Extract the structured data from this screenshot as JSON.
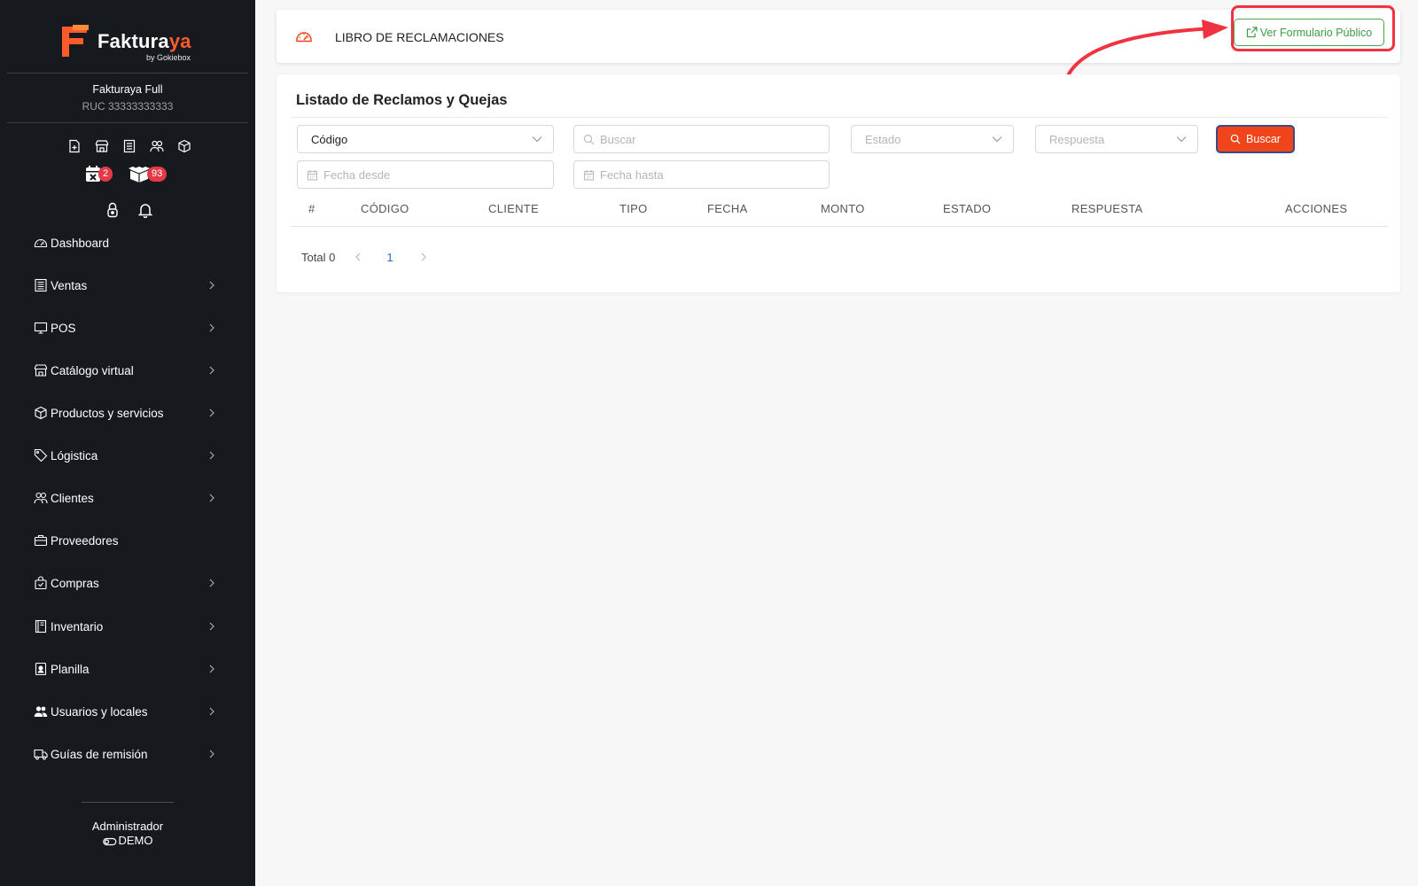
{
  "brand": {
    "name_main": "Faktura",
    "name_accent": "ya",
    "byline": "by Gokiebox",
    "accent_color": "#ff5a2c"
  },
  "company": {
    "name": "Fakturaya Full",
    "ruc": "RUC 33333333333"
  },
  "quick_icons": [
    "new-document-icon",
    "store-icon",
    "receipt-icon",
    "users-icon",
    "box-icon"
  ],
  "notifications": {
    "calendar_count": "2",
    "packages_count": "93"
  },
  "sidebar": {
    "items": [
      {
        "label": "Dashboard",
        "icon": "dashboard-icon",
        "has_children": false
      },
      {
        "label": "Ventas",
        "icon": "receipt-icon",
        "has_children": true
      },
      {
        "label": "POS",
        "icon": "monitor-icon",
        "has_children": true
      },
      {
        "label": "Catálogo virtual",
        "icon": "store-icon",
        "has_children": true
      },
      {
        "label": "Productos y servicios",
        "icon": "box-icon",
        "has_children": true
      },
      {
        "label": "Lógistica",
        "icon": "tag-icon",
        "has_children": true
      },
      {
        "label": "Clientes",
        "icon": "users-icon",
        "has_children": true
      },
      {
        "label": "Proveedores",
        "icon": "briefcase-icon",
        "has_children": false
      },
      {
        "label": "Compras",
        "icon": "shopping-bag-icon",
        "has_children": true
      },
      {
        "label": "Inventario",
        "icon": "book-icon",
        "has_children": true
      },
      {
        "label": "Planilla",
        "icon": "badge-icon",
        "has_children": true
      },
      {
        "label": "Usuarios y locales",
        "icon": "user-group-icon",
        "has_children": true
      },
      {
        "label": "Guías de remisión",
        "icon": "truck-icon",
        "has_children": true
      }
    ],
    "footer_role": "Administrador",
    "footer_mode": "DEMO"
  },
  "header": {
    "title": "LIBRO DE RECLAMACIONES",
    "public_form_button": "Ver Formulario Público",
    "highlight_color": "#ef3340"
  },
  "main": {
    "title": "Listado de Reclamos y Quejas",
    "filters": {
      "field_select": "Código",
      "search_placeholder": "Buscar",
      "estado_placeholder": "Estado",
      "respuesta_placeholder": "Respuesta",
      "date_from_placeholder": "Fecha desde",
      "date_to_placeholder": "Fecha hasta",
      "search_button": "Buscar"
    },
    "columns": [
      "#",
      "CÓDIGO",
      "CLIENTE",
      "TIPO",
      "FECHA",
      "MONTO",
      "ESTADO",
      "RESPUESTA",
      "ACCIONES"
    ],
    "rows": [],
    "pagination": {
      "total": "Total 0",
      "current_page": "1"
    },
    "primary_color": "#f0441a"
  }
}
